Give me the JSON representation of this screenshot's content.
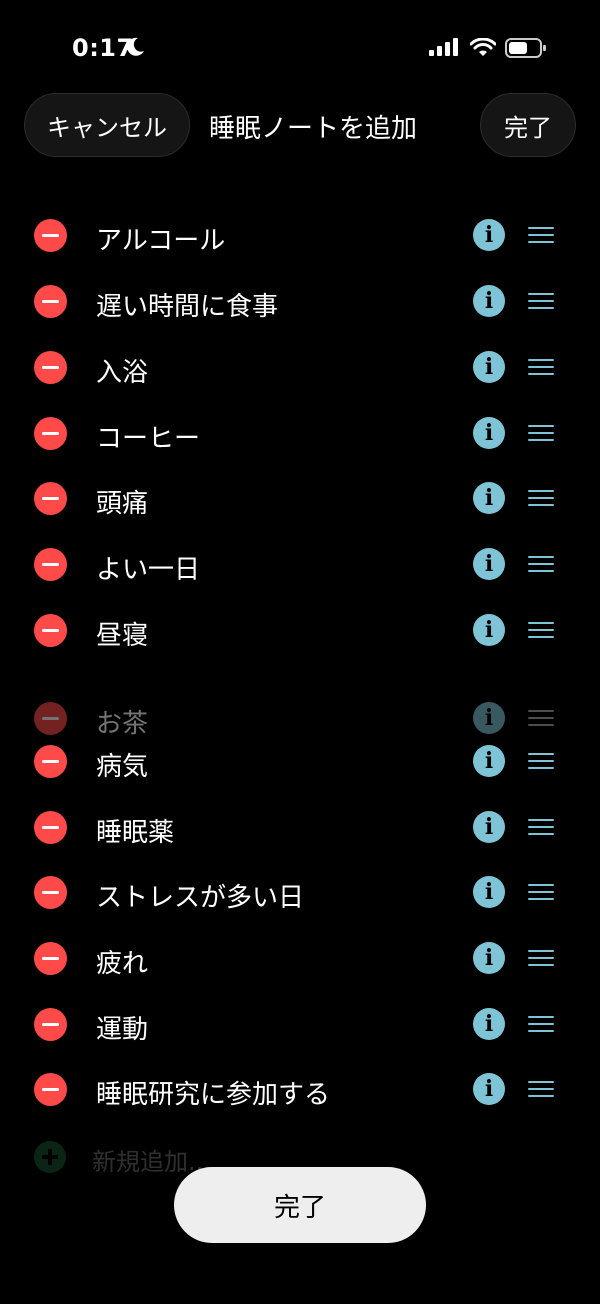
{
  "status_bar": {
    "time": "0:17"
  },
  "header": {
    "cancel_label": "キャンセル",
    "title": "睡眠ノートを追加",
    "done_label": "完了"
  },
  "items": [
    {
      "label": "アルコール"
    },
    {
      "label": "遅い時間に食事"
    },
    {
      "label": "入浴"
    },
    {
      "label": "コーヒー"
    },
    {
      "label": "頭痛"
    },
    {
      "label": "よい一日"
    },
    {
      "label": "昼寝"
    },
    {
      "label": "お茶"
    },
    {
      "label": "病気"
    },
    {
      "label": "睡眠薬"
    },
    {
      "label": "ストレスが多い日"
    },
    {
      "label": "疲れ"
    },
    {
      "label": "運動"
    },
    {
      "label": "睡眠研究に参加する"
    }
  ],
  "add_new_label": "新規追加...",
  "footer": {
    "done_label": "完了"
  },
  "colors": {
    "remove": "#ff4a4a",
    "accent": "#7fc4d6",
    "add": "#1f6b3a"
  }
}
